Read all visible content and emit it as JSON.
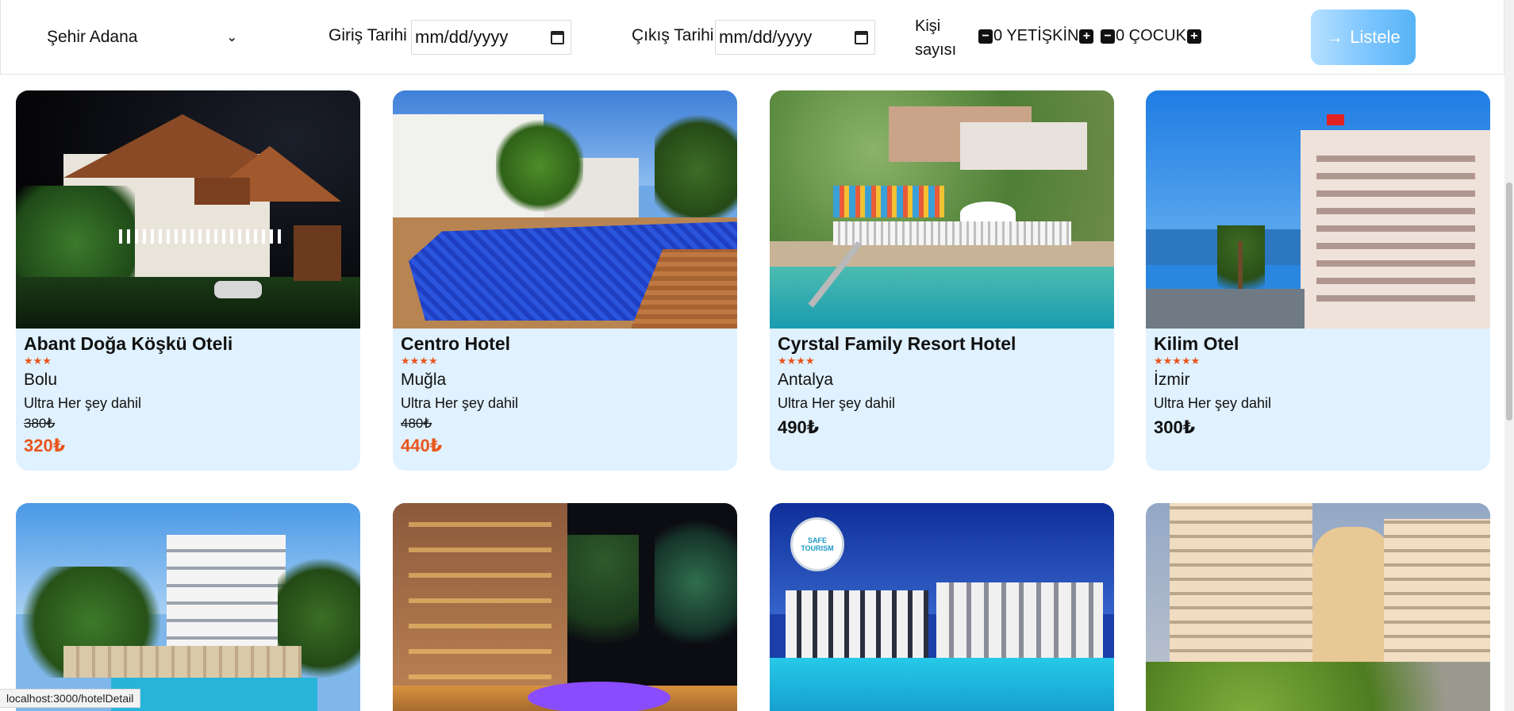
{
  "filters": {
    "city_label": "Şehir Adana",
    "checkin_label": "Giriş Tarihi",
    "checkin_placeholder": "mm/dd/yyyy",
    "checkout_label": "Çıkış Tarihi",
    "checkout_placeholder": "mm/dd/yyyy",
    "persons_label": "Kişi sayısı",
    "adult_text": "0 YETİŞKİN",
    "child_text": "0 ÇOCUK",
    "minus_symbol": "−",
    "plus_symbol": "+",
    "list_button_label": "Listele",
    "list_button_icon": "arrow-right-icon"
  },
  "colors": {
    "accent": "#e8551c",
    "card_bg": "#e0f1ff",
    "button_gradient_end": "#56b3f5"
  },
  "hotels": [
    {
      "name": "Abant Doğa Köşkü Oteli",
      "stars": "★★★",
      "city": "Bolu",
      "board": "Ultra Her şey dahil",
      "old_price": "380₺",
      "price": "320₺",
      "discounted": true
    },
    {
      "name": "Centro Hotel",
      "stars": "★★★★",
      "city": "Muğla",
      "board": "Ultra Her şey dahil",
      "old_price": "480₺",
      "price": "440₺",
      "discounted": true
    },
    {
      "name": "Cyrstal Family Resort Hotel",
      "stars": "★★★★",
      "city": "Antalya",
      "board": "Ultra Her şey dahil",
      "price": "490₺",
      "discounted": false
    },
    {
      "name": "Kilim Otel",
      "stars": "★★★★★",
      "city": "İzmir",
      "board": "Ultra Her şey dahil",
      "price": "300₺",
      "discounted": false
    }
  ],
  "row2_badge": "SAFE TOURISM",
  "status_url": "localhost:3000/hotelDetail"
}
